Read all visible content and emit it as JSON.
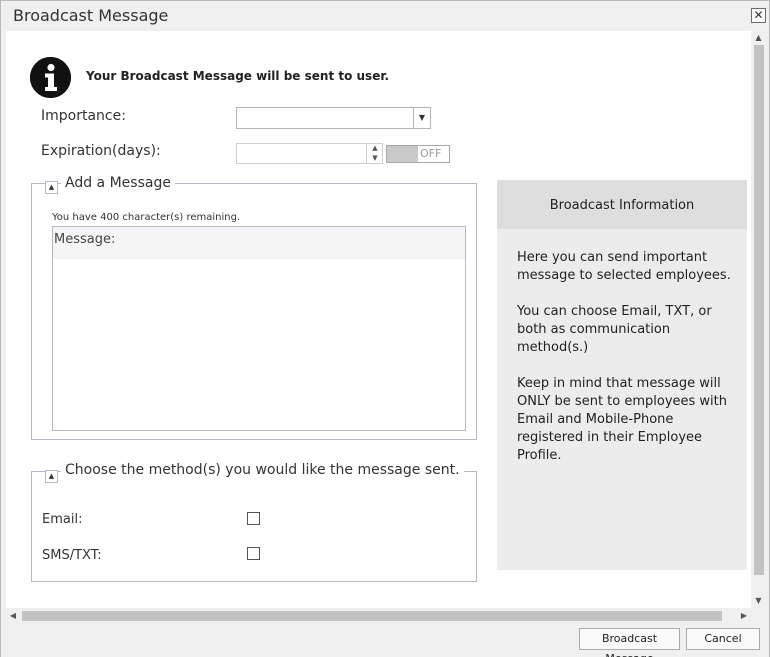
{
  "window": {
    "title": "Broadcast Message",
    "close_glyph": "✕"
  },
  "notice": {
    "icon": "info-icon",
    "text": "Your Broadcast Message will be sent to user."
  },
  "form": {
    "importance_label": "Importance:",
    "importance_value": "",
    "expiration_label": "Expiration(days):",
    "expiration_value": "",
    "toggle_state": "OFF"
  },
  "message_section": {
    "legend": "Add a Message",
    "remaining_text": "You have 400 character(s) remaining.",
    "message_placeholder": "Message:"
  },
  "method_section": {
    "legend": "Choose the method(s) you would like the message sent.",
    "email_label": "Email:",
    "email_checked": false,
    "sms_label": "SMS/TXT:",
    "sms_checked": false
  },
  "info_panel": {
    "title": "Broadcast Information",
    "paragraphs": [
      "Here you can send important message to selected employees.",
      "You can choose Email, TXT, or both as communication method(s.)",
      "Keep in mind that message will ONLY be sent to employees with Email and Mobile-Phone registered in their Employee Profile."
    ]
  },
  "footer": {
    "primary_label": "Broadcast Message",
    "cancel_label": "Cancel"
  },
  "colors": {
    "dialog_bg": "#f0f0f0",
    "panel_bg": "#ececec",
    "panel_header_bg": "#dedede",
    "border": "#b7b7c7"
  }
}
